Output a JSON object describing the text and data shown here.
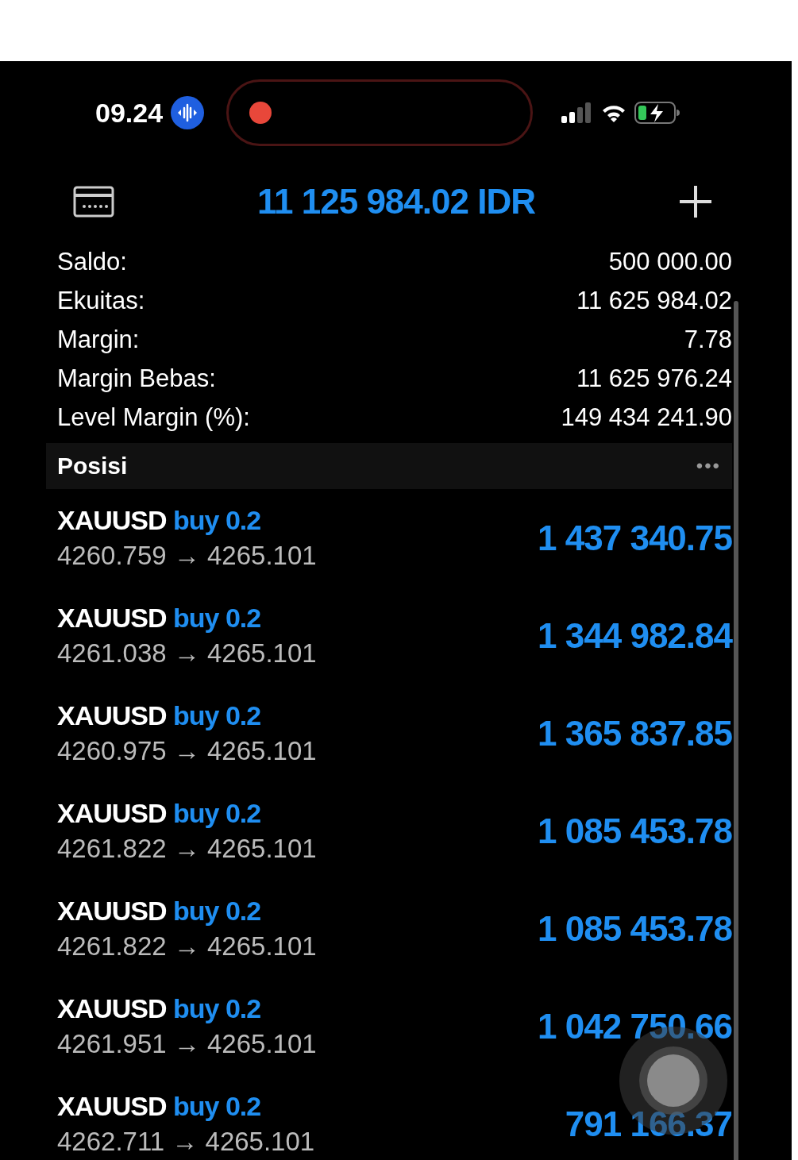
{
  "status_bar": {
    "time": "09.24",
    "recording": true
  },
  "header": {
    "balance": "11 125 984.02 IDR"
  },
  "summary": [
    {
      "label": "Saldo:",
      "value": "500 000.00"
    },
    {
      "label": "Ekuitas:",
      "value": "11 625 984.02"
    },
    {
      "label": "Margin:",
      "value": "7.78"
    },
    {
      "label": "Margin Bebas:",
      "value": "11 625 976.24"
    },
    {
      "label": "Level Margin (%):",
      "value": "149 434 241.90"
    }
  ],
  "positions_section": {
    "title": "Posisi",
    "menu": "•••"
  },
  "positions": [
    {
      "symbol": "XAUUSD",
      "side": "buy",
      "volume": "0.2",
      "open_price": "4260.759",
      "arrow": "→",
      "current_price": "4265.101",
      "profit": "1 437 340.75"
    },
    {
      "symbol": "XAUUSD",
      "side": "buy",
      "volume": "0.2",
      "open_price": "4261.038",
      "arrow": "→",
      "current_price": "4265.101",
      "profit": "1 344 982.84"
    },
    {
      "symbol": "XAUUSD",
      "side": "buy",
      "volume": "0.2",
      "open_price": "4260.975",
      "arrow": "→",
      "current_price": "4265.101",
      "profit": "1 365 837.85"
    },
    {
      "symbol": "XAUUSD",
      "side": "buy",
      "volume": "0.2",
      "open_price": "4261.822",
      "arrow": "→",
      "current_price": "4265.101",
      "profit": "1 085 453.78"
    },
    {
      "symbol": "XAUUSD",
      "side": "buy",
      "volume": "0.2",
      "open_price": "4261.822",
      "arrow": "→",
      "current_price": "4265.101",
      "profit": "1 085 453.78"
    },
    {
      "symbol": "XAUUSD",
      "side": "buy",
      "volume": "0.2",
      "open_price": "4261.951",
      "arrow": "→",
      "current_price": "4265.101",
      "profit": "1 042 750.66"
    },
    {
      "symbol": "XAUUSD",
      "side": "buy",
      "volume": "0.2",
      "open_price": "4262.711",
      "arrow": "→",
      "current_price": "4265.101",
      "profit": "791 166.37"
    }
  ]
}
